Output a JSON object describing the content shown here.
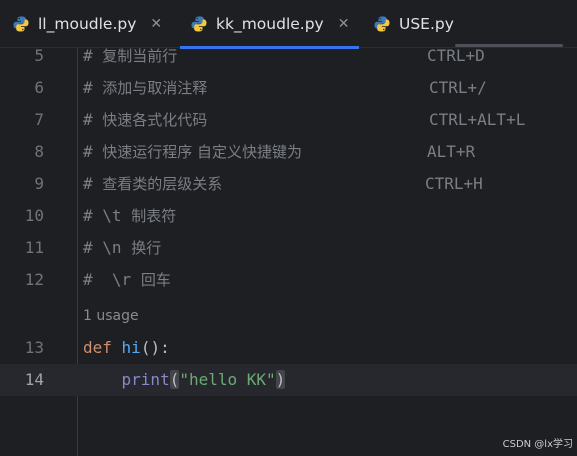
{
  "tabs": [
    {
      "label": "ll_moudle.py",
      "close": "✕",
      "active": false,
      "icon": "python-icon"
    },
    {
      "label": "kk_moudle.py",
      "close": "✕",
      "active": true,
      "icon": "python-icon"
    },
    {
      "label": "USE.py",
      "close": "",
      "active": false,
      "icon": "python-icon"
    }
  ],
  "lines": [
    {
      "num": "5",
      "hash": "#",
      "text": "复制当前行",
      "shortcut": "CTRL+D"
    },
    {
      "num": "6",
      "hash": "#",
      "text": "添加与取消注释",
      "shortcut": "CTRL+/"
    },
    {
      "num": "7",
      "hash": "#",
      "text": "快速各式化代码",
      "shortcut": "CTRL+ALT+L"
    },
    {
      "num": "8",
      "hash": "#",
      "text": "快速运行程序 自定义快捷键为",
      "shortcut": "ALT+R"
    },
    {
      "num": "9",
      "hash": "#",
      "text": "查看类的层级关系",
      "shortcut": "CTRL+H"
    },
    {
      "num": "10",
      "hash": "#",
      "esc": "\\t",
      "text": "制表符"
    },
    {
      "num": "11",
      "hash": "#",
      "esc": "\\n",
      "text": "换行"
    },
    {
      "num": "12",
      "hash": "#",
      "esc": "\\r",
      "text": "回车"
    }
  ],
  "usage_hint": "1 usage",
  "def_line": {
    "num": "13",
    "kw": "def",
    "name": "hi",
    "rest": "():"
  },
  "print_line": {
    "num": "14",
    "builtin": "print",
    "open": "(",
    "string": "\"hello KK\"",
    "close": ")"
  },
  "watermark": "CSDN @lx学习",
  "colors": {
    "background": "#1e1f22",
    "accent": "#3574f0",
    "comment": "#7a7e85",
    "keyword": "#cf8e6d",
    "function": "#56a8f5",
    "string": "#6aab73"
  }
}
